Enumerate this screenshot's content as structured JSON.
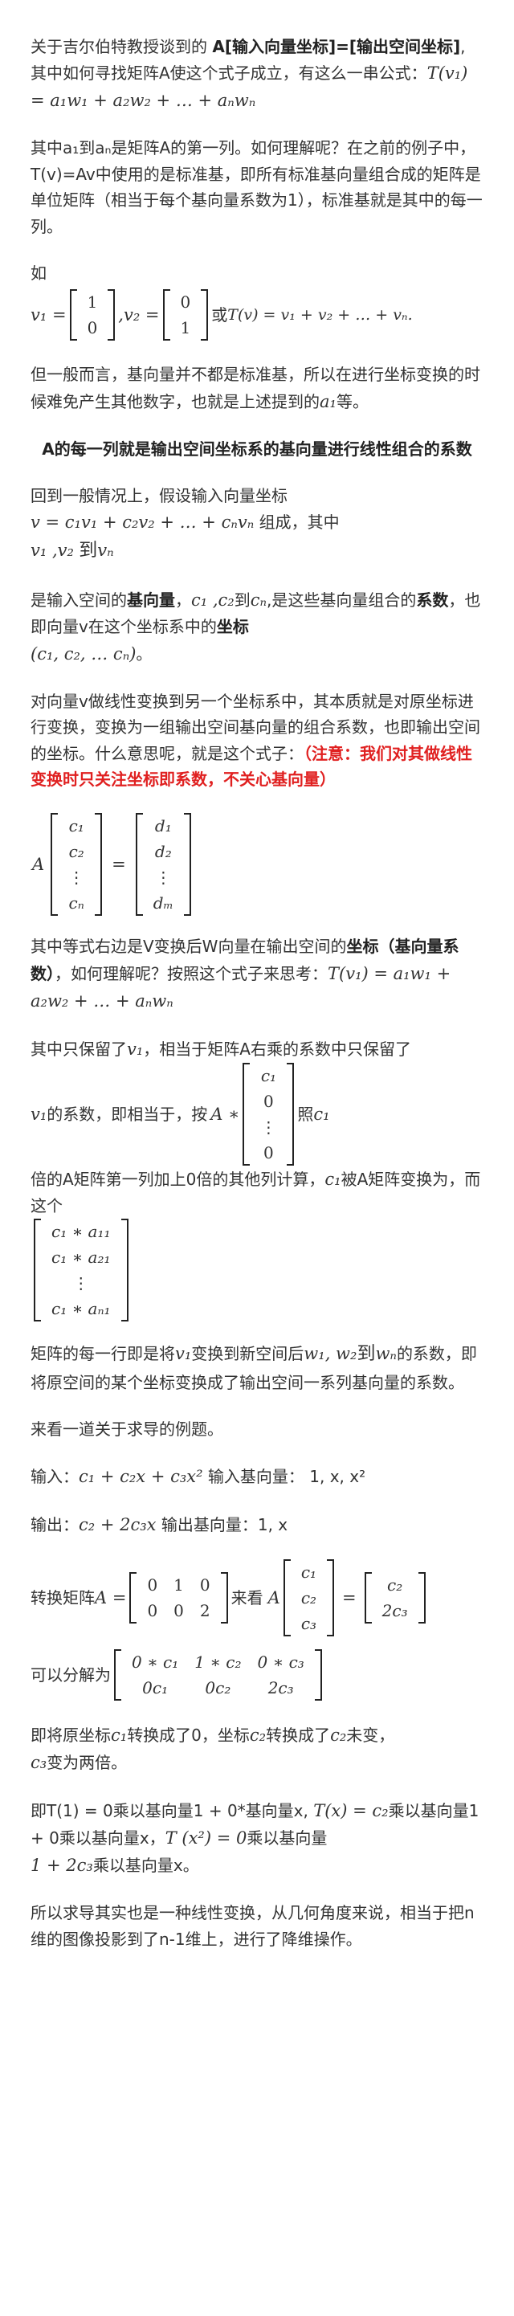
{
  "p1": {
    "t1": "关于吉尔伯特教授谈到的 ",
    "b1": "A[输入向量坐标]=[输出空间坐标]",
    "t2": ", 其中如何寻找矩阵A使这个式子成立，有这么一串公式：",
    "f": "T(v₁) = a₁w₁ + a₂w₂ + … + aₙwₙ"
  },
  "p2": {
    "t1": "其中a₁到aₙ是矩阵A的第一列。如何理解呢？在之前的例子中，T(v)=Av中使用的是标准基，即所有标准基向量组合成的矩阵是单位矩阵（相当于每个基向量系数为1），标准基就是其中的每一列。"
  },
  "p3": {
    "ru": "如",
    "v1": "v₁ =",
    "v1m": [
      "1",
      "0"
    ],
    "v2": ",v₂ =",
    "v2m": [
      "0",
      "1"
    ],
    "huo": "或",
    "f": "T(v) = v₁ + v₂ + … + vₙ."
  },
  "p4": {
    "t1": "但一般而言，基向量并不都是标准基，所以在进行坐标变换的时候难免产生其他数字，也就是上述提到的",
    "f": "a₁",
    "t2": "等。"
  },
  "h1": "A的每一列就是输出空间坐标系的基向量进行线性组合的系数",
  "p5": {
    "t1": "回到一般情况上，假设输入向量坐标",
    "f1": "v = c₁v₁ + c₂v₂ + … + cₙvₙ",
    "t2": " 组成，其中",
    "f2": "v₁ ,v₂",
    "dao": "到",
    "f3": "vₙ"
  },
  "p6": {
    "t1": "是输入空间的",
    "b1": "基向量",
    "t2": "，",
    "f1": "c₁ ,c₂",
    "t3": "到",
    "f2": "cₙ",
    "t4": ",是这些基向量组合的",
    "b2": "系数",
    "t5": "，也即向量v在这个坐标系中的",
    "b3": "坐标",
    "f3": "(c₁, c₂, … cₙ)",
    "t6": "。"
  },
  "p7": {
    "t1": "对向量v做线性变换到另一个坐标系中，其本质就是对原坐标进行变换，变换为一组输出空间基向量的组合系数，也即输出空间的坐标。什么意思呢，就是这个式子：",
    "red": "（注意：我们对其做线性变换时只关注坐标即系数，不关心基向量）"
  },
  "eq1": {
    "A": "A",
    "left": [
      "c₁",
      "c₂",
      "⋮",
      "cₙ"
    ],
    "eq": "=",
    "right": [
      "d₁",
      "d₂",
      "⋮",
      "dₘ"
    ]
  },
  "p8": {
    "t1": "其中等式右边是V变换后W向量在输出空间的",
    "b1": "坐标（基向量系数）",
    "t2": "，如何理解呢？按照这个式子来思考：",
    "f": "T(v₁) = a₁w₁ + a₂w₂ + … + aₙwₙ"
  },
  "p9": {
    "t1": "其中只保留了",
    "f1": "v₁",
    "t2": "，相当于矩阵A右乘的系数中只保留了",
    "f2": "v₁",
    "t3": "的系数，即相当于，按",
    "f3": "A ∗",
    "mat": [
      "c₁",
      "0",
      "⋮",
      "0"
    ],
    "t4": "照",
    "f4": "c₁",
    "t5": "倍的A矩阵第一列加上0倍的其他列计算，",
    "f5": "c₁",
    "t6": "被A矩阵变换为，而这个",
    "mat2": [
      "c₁ ∗ a₁₁",
      "c₁ ∗ a₂₁",
      "⋮",
      "c₁ ∗ aₙ₁"
    ]
  },
  "p10": {
    "t1": "矩阵的每一行即是将",
    "f1": "v₁",
    "t2": "变换到新空间后",
    "f2": "w₁, w₂",
    "t3": "到",
    "f3": "wₙ",
    "t4": "的系数，即将原空间的某个坐标变换成了输出空间一系列基向量的系数。"
  },
  "p11": "来看一道关于求导的例题。",
  "p12": {
    "t1": "输入：",
    "f": "c₁ + c₂x + c₃x²",
    "t2": " 输入基向量： 1, x, x²"
  },
  "p13": {
    "t1": "输出：",
    "f": "c₂ + 2c₃x",
    "t2": " 输出基向量：1, x"
  },
  "p14": {
    "t1": "转换矩阵",
    "f1": "A =",
    "A": [
      [
        "0",
        "1",
        "0"
      ],
      [
        "0",
        "0",
        "2"
      ]
    ],
    "t2": "来看",
    "f2": "A",
    "cv": [
      "c₁",
      "c₂",
      "c₃"
    ],
    "eq": "=",
    "rv": [
      "c₂",
      "2c₃"
    ]
  },
  "p15": {
    "t1": "可以分解为",
    "m": [
      [
        "0 ∗ c₁",
        "1 ∗ c₂",
        "0 ∗ c₃"
      ],
      [
        "0c₁",
        "0c₂",
        "2c₃"
      ]
    ]
  },
  "p16": {
    "t1": "即将原坐标",
    "f1": "c₁",
    "t2": "转换成了0，坐标",
    "f2": "c₂",
    "t3": "转换成了",
    "f3": "c₂",
    "t4": "未变，",
    "f4": "c₃",
    "t5": "变为两倍。"
  },
  "p17": {
    "t1": "即T(1) = 0乘以基向量1 + 0*基向量x, ",
    "f1": "T(x) = c₂",
    "t2": "乘以基向量1 + 0乘以基向量x，",
    "f2": "T (x²) = 0",
    "t3": "乘以基向量",
    "f3": "1 + 2c₃",
    "t4": "乘以基向量x。"
  },
  "p18": "所以求导其实也是一种线性变换，从几何角度来说，相当于把n维的图像投影到了n-1维上，进行了降维操作。"
}
